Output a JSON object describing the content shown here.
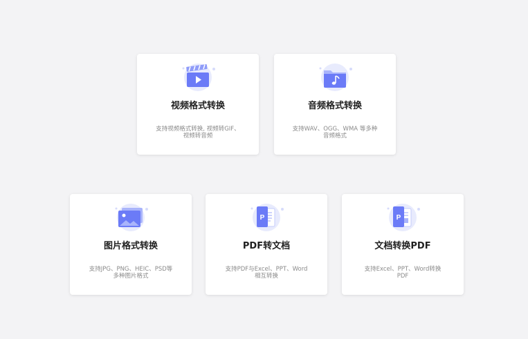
{
  "cards": [
    {
      "title": "视频格式转换",
      "desc": "支持视频格式转换, 视频转GIF、视频转音频",
      "icon": "video-clapper-icon"
    },
    {
      "title": "音频格式转换",
      "desc": "支持WAV、OGG、WMA 等多种音频格式",
      "icon": "audio-folder-icon"
    },
    {
      "title": "图片格式转换",
      "desc": "支持JPG、PNG、HEIC、PSD等多种图片格式",
      "icon": "image-icon"
    },
    {
      "title": "PDF转文档",
      "desc": "支持PDF与Excel、PPT、Word相互转换",
      "icon": "pdf-to-doc-icon"
    },
    {
      "title": "文档转换PDF",
      "desc": "支持Excel、PPT、Word转换PDF",
      "icon": "doc-to-pdf-icon"
    }
  ],
  "colors": {
    "accent": "#6b7bf7",
    "accent_light": "#a9b4fb",
    "halo": "#e8ebfd",
    "background": "#f3f3f5"
  }
}
